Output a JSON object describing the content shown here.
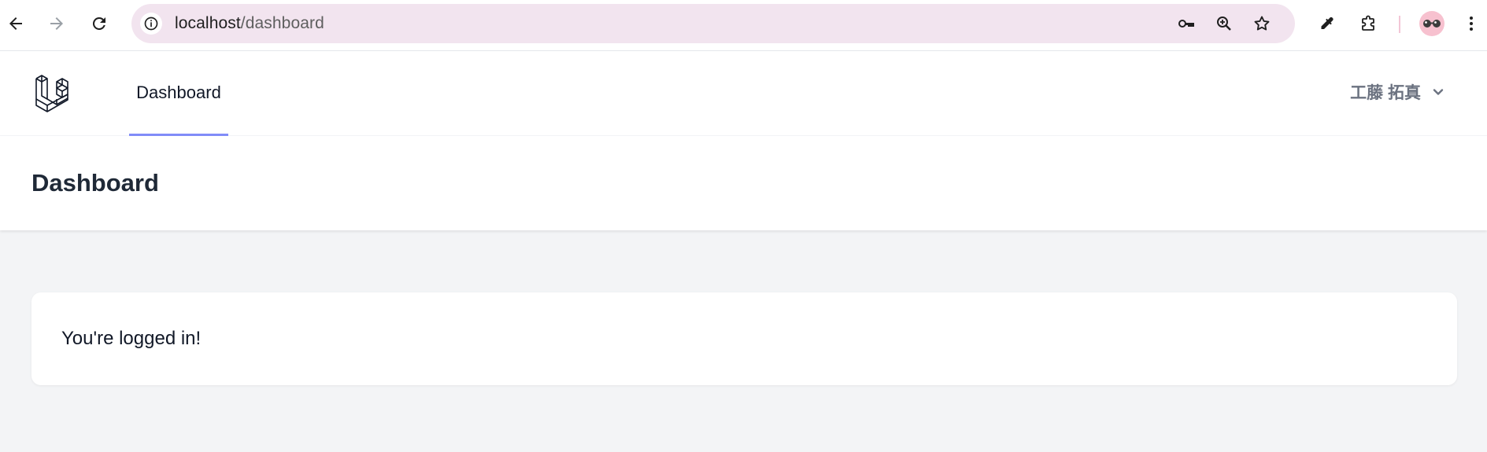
{
  "browser": {
    "url_host": "localhost",
    "url_path": "/dashboard",
    "icons": [
      "back-icon",
      "forward-icon",
      "reload-icon",
      "site-info-icon",
      "password-key-icon",
      "zoom-icon",
      "bookmark-star-icon",
      "eyedropper-icon",
      "extensions-icon",
      "profile-avatar",
      "more-menu-icon"
    ]
  },
  "nav": {
    "links": [
      {
        "label": "Dashboard",
        "active": true
      }
    ],
    "user_name": "工藤 拓真",
    "accent_color": "#818cf8"
  },
  "header": {
    "title": "Dashboard"
  },
  "main": {
    "message": "You're logged in!"
  }
}
